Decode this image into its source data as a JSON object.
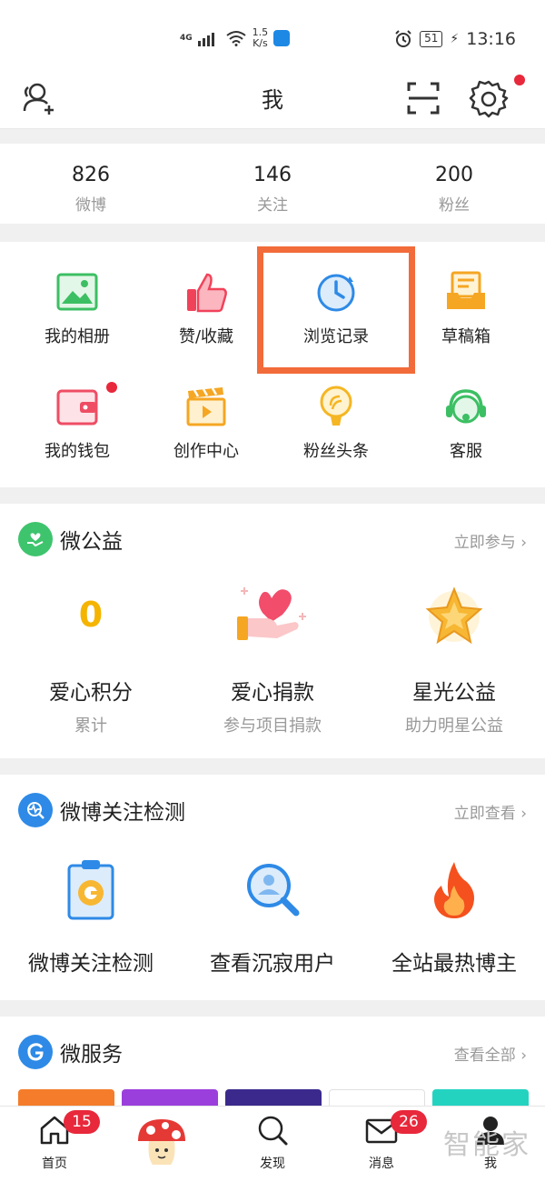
{
  "status_bar": {
    "network": "4G",
    "speed_value": "1.5",
    "speed_unit": "K/s",
    "battery": "51",
    "time": "13:16"
  },
  "header": {
    "title": "我"
  },
  "stats": [
    {
      "value": "826",
      "label": "微博"
    },
    {
      "value": "146",
      "label": "关注"
    },
    {
      "value": "200",
      "label": "粉丝"
    }
  ],
  "grid": {
    "items": [
      {
        "label": "我的相册",
        "icon": "album-icon"
      },
      {
        "label": "赞/收藏",
        "icon": "thumbs-up-icon"
      },
      {
        "label": "浏览记录",
        "icon": "clock-icon"
      },
      {
        "label": "草稿箱",
        "icon": "drafts-icon"
      },
      {
        "label": "我的钱包",
        "icon": "wallet-icon"
      },
      {
        "label": "创作中心",
        "icon": "clapperboard-icon"
      },
      {
        "label": "粉丝头条",
        "icon": "bulb-icon"
      },
      {
        "label": "客服",
        "icon": "headset-icon"
      }
    ]
  },
  "charity": {
    "title": "微公益",
    "link": "立即参与",
    "points_value": "0",
    "items": [
      {
        "title": "爱心积分",
        "sub": "累计"
      },
      {
        "title": "爱心捐款",
        "sub": "参与项目捐款"
      },
      {
        "title": "星光公益",
        "sub": "助力明星公益"
      }
    ]
  },
  "detect": {
    "title": "微博关注检测",
    "link": "立即查看",
    "items": [
      {
        "title": "微博关注检测"
      },
      {
        "title": "查看沉寂用户"
      },
      {
        "title": "全站最热博主"
      }
    ]
  },
  "services": {
    "title": "微服务",
    "link": "查看全部"
  },
  "tabbar": {
    "home": "首页",
    "home_badge": "15",
    "discover": "发现",
    "messages": "消息",
    "messages_badge": "26",
    "me": "我"
  },
  "watermark": "智能家",
  "colors": {
    "accent_red": "#e8283b",
    "highlight": "#f26b3a",
    "charity_green": "#3ec46d",
    "detect_blue": "#2e8ae6"
  }
}
